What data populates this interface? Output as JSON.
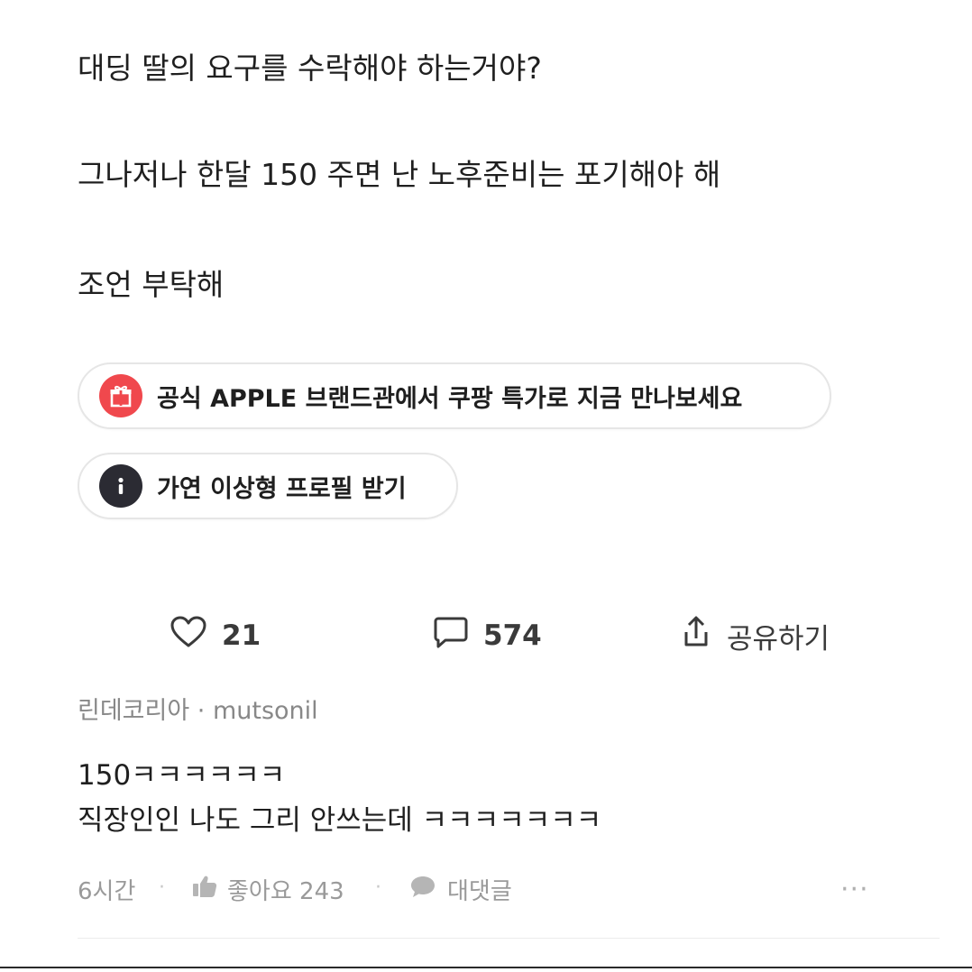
{
  "post": {
    "lines": [
      "대딩 딸의 요구를 수락해야 하는거야?",
      "그나저나 한달 150 주면 난 노후준비는 포기해야 해",
      "조언 부탁해"
    ]
  },
  "promo": {
    "ad_label": "공식 APPLE 브랜드관에서 쿠팡 특가로 지금 만나보세요",
    "ad_icon": "gift-icon",
    "ad_icon_color": "#f0484d",
    "info_label": "가연 이상형 프로필 받기",
    "info_icon": "info-icon",
    "info_icon_color": "#2b2b33"
  },
  "actions": {
    "like_count": "21",
    "comment_count": "574",
    "share_label": "공유하기"
  },
  "comment": {
    "author_meta": "린데코리아 · mutsonil",
    "lines": [
      "150ㅋㅋㅋㅋㅋㅋ",
      "직장인인 나도 그리 안쓰는데 ㅋㅋㅋㅋㅋㅋㅋ"
    ],
    "time": "6시간",
    "like_label": "좋아요 243",
    "reply_label": "대댓글",
    "more_label": "···"
  }
}
